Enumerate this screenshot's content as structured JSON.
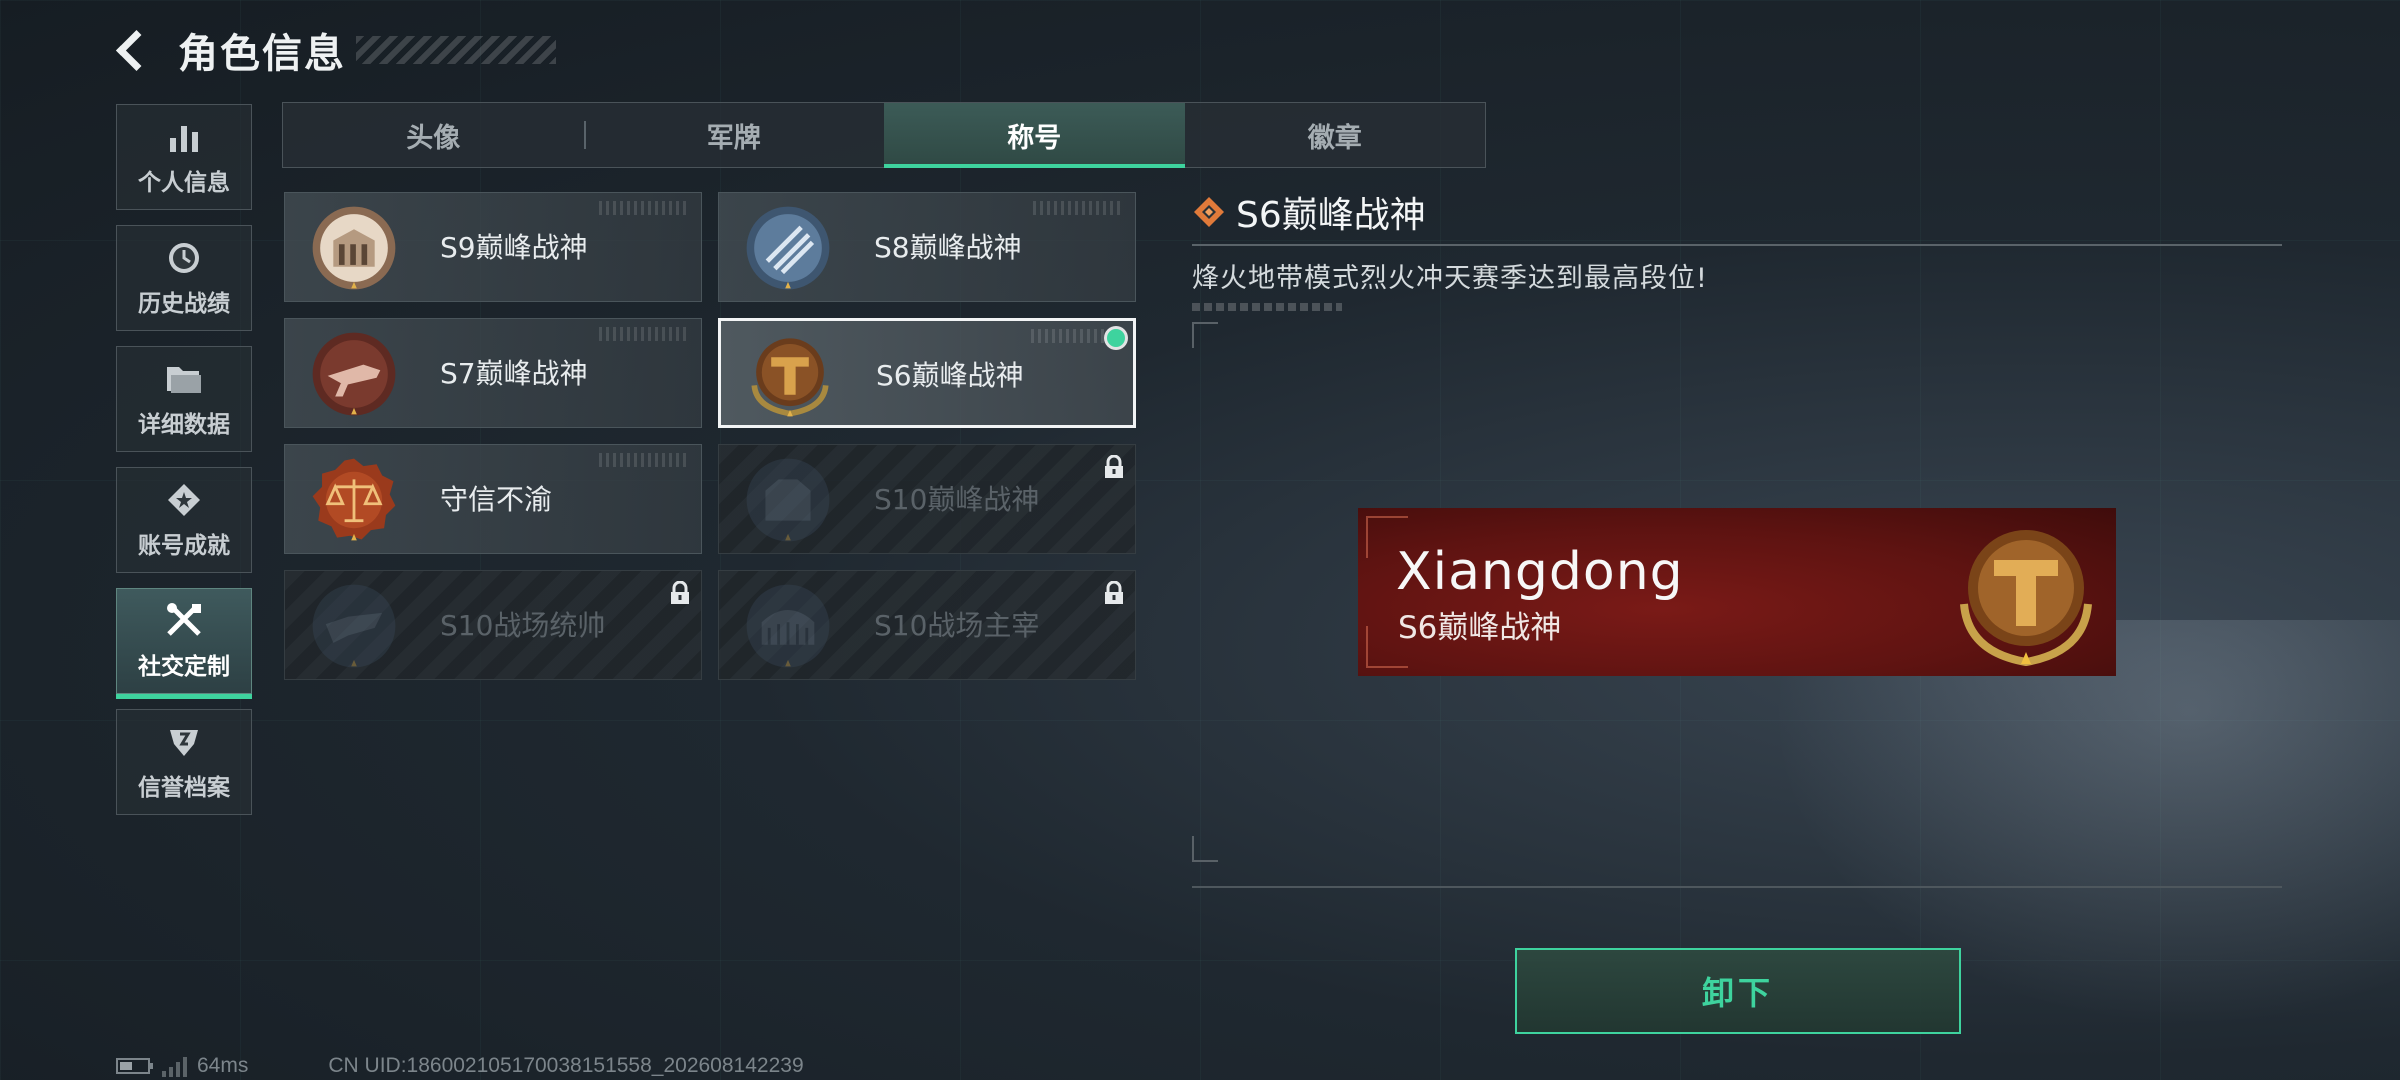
{
  "header": {
    "title": "角色信息"
  },
  "sidebar": {
    "items": [
      {
        "label": "个人信息",
        "icon": "bar-chart-icon",
        "active": false
      },
      {
        "label": "历史战绩",
        "icon": "clock-icon",
        "active": false
      },
      {
        "label": "详细数据",
        "icon": "folder-icon",
        "active": false
      },
      {
        "label": "账号成就",
        "icon": "achievement-icon",
        "active": false
      },
      {
        "label": "社交定制",
        "icon": "tools-icon",
        "active": true
      },
      {
        "label": "信誉档案",
        "icon": "shield-icon",
        "active": false
      }
    ]
  },
  "tabs": [
    {
      "label": "头像",
      "active": false
    },
    {
      "label": "军牌",
      "active": false
    },
    {
      "label": "称号",
      "active": true
    },
    {
      "label": "徽章",
      "active": false
    }
  ],
  "titles": [
    {
      "name": "S9巅峰战神",
      "icon": "s9-medal-icon",
      "locked": false,
      "selected": false
    },
    {
      "name": "S8巅峰战神",
      "icon": "s8-medal-icon",
      "locked": false,
      "selected": false
    },
    {
      "name": "S7巅峰战神",
      "icon": "s7-medal-icon",
      "locked": false,
      "selected": false
    },
    {
      "name": "S6巅峰战神",
      "icon": "s6-medal-icon",
      "locked": false,
      "selected": true,
      "equipped": true
    },
    {
      "name": "守信不渝",
      "icon": "scales-medal-icon",
      "locked": false,
      "selected": false
    },
    {
      "name": "S10巅峰战神",
      "icon": "s10-medal-icon",
      "locked": true,
      "selected": false
    },
    {
      "name": "S10战场统帅",
      "icon": "s10-commander-medal-icon",
      "locked": true,
      "selected": false
    },
    {
      "name": "S10战场主宰",
      "icon": "s10-dominator-medal-icon",
      "locked": true,
      "selected": false
    }
  ],
  "detail": {
    "title": "S6巅峰战神",
    "description": "烽火地带模式烈火冲天赛季达到最高段位!"
  },
  "preview": {
    "player_name": "Xiangdong",
    "title": "S6巅峰战神"
  },
  "action": {
    "label": "卸下"
  },
  "status": {
    "ping": "64ms",
    "uid": "CN UID:1860021051700381515​58_202608142239"
  },
  "colors": {
    "accent": "#3ed39e",
    "banner_red": "#6e1714",
    "medal_gold": "#c89a48",
    "title_icon_orange": "#e07a3a"
  }
}
